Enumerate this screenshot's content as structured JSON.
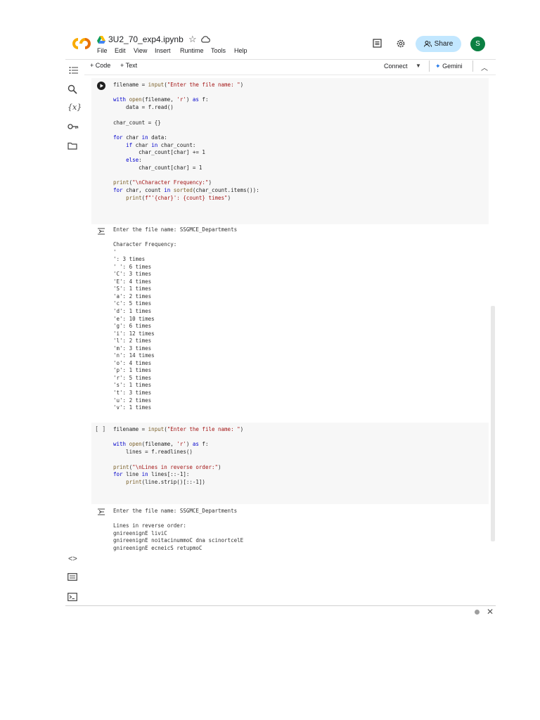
{
  "header": {
    "title": "3U2_70_exp4.ipynb",
    "menu": [
      "File",
      "Edit",
      "View",
      "Insert",
      "Runtime",
      "Tools",
      "Help"
    ],
    "share_label": "Share",
    "avatar_letter": "S"
  },
  "toolbar": {
    "add_code": "+ Code",
    "add_text": "+ Text",
    "connect": "Connect",
    "gemini": "Gemini"
  },
  "cells": [
    {
      "run_state": "play",
      "code": [
        [
          [
            "filename = ",
            "tx"
          ],
          [
            "input",
            "bi"
          ],
          [
            "(",
            "tx"
          ],
          [
            "\"Enter the file name: \"",
            "str"
          ],
          [
            ")",
            "tx"
          ]
        ],
        [],
        [
          [
            "with ",
            "kw"
          ],
          [
            "open",
            "bi"
          ],
          [
            "(filename, ",
            "tx"
          ],
          [
            "'r'",
            "str"
          ],
          [
            ") ",
            "tx"
          ],
          [
            "as",
            "kw"
          ],
          [
            " f:",
            "tx"
          ]
        ],
        [
          [
            "    data = f.read()",
            "tx"
          ]
        ],
        [],
        [
          [
            "char_count = {}",
            "tx"
          ]
        ],
        [],
        [
          [
            "for ",
            "kw"
          ],
          [
            "char ",
            "tx"
          ],
          [
            "in",
            "kw"
          ],
          [
            " data:",
            "tx"
          ]
        ],
        [
          [
            "    ",
            "tx"
          ],
          [
            "if ",
            "kw"
          ],
          [
            "char ",
            "tx"
          ],
          [
            "in",
            "kw"
          ],
          [
            " char_count:",
            "tx"
          ]
        ],
        [
          [
            "        char_count[char] += 1",
            "tx"
          ]
        ],
        [
          [
            "    ",
            "tx"
          ],
          [
            "else",
            "kw"
          ],
          [
            ":",
            "tx"
          ]
        ],
        [
          [
            "        char_count[char] = 1",
            "tx"
          ]
        ],
        [],
        [
          [
            "print",
            "bi"
          ],
          [
            "(",
            "tx"
          ],
          [
            "\"\\nCharacter Frequency:\"",
            "str"
          ],
          [
            ")",
            "tx"
          ]
        ],
        [
          [
            "for ",
            "kw"
          ],
          [
            "char, count ",
            "tx"
          ],
          [
            "in ",
            "kw"
          ],
          [
            "sorted",
            "bi"
          ],
          [
            "(char_count.items()):",
            "tx"
          ]
        ],
        [
          [
            "    ",
            "tx"
          ],
          [
            "print",
            "bi"
          ],
          [
            "(",
            "tx"
          ],
          [
            "f\"'{char}': {count} times\"",
            "str"
          ],
          [
            ")",
            "tx"
          ]
        ]
      ],
      "output": [
        "Enter the file name: SSGMCE_Departments",
        "",
        "Character Frequency:",
        "'",
        "': 3 times",
        "' ': 6 times",
        "'C': 3 times",
        "'E': 4 times",
        "'S': 1 times",
        "'a': 2 times",
        "'c': 5 times",
        "'d': 1 times",
        "'e': 10 times",
        "'g': 6 times",
        "'i': 12 times",
        "'l': 2 times",
        "'m': 3 times",
        "'n': 14 times",
        "'o': 4 times",
        "'p': 1 times",
        "'r': 5 times",
        "'s': 1 times",
        "'t': 3 times",
        "'u': 2 times",
        "'v': 1 times"
      ]
    },
    {
      "run_state": "[ ]",
      "code": [
        [
          [
            "filename = ",
            "tx"
          ],
          [
            "input",
            "bi"
          ],
          [
            "(",
            "tx"
          ],
          [
            "\"Enter the file name: \"",
            "str"
          ],
          [
            ")",
            "tx"
          ]
        ],
        [],
        [
          [
            "with ",
            "kw"
          ],
          [
            "open",
            "bi"
          ],
          [
            "(filename, ",
            "tx"
          ],
          [
            "'r'",
            "str"
          ],
          [
            ") ",
            "tx"
          ],
          [
            "as",
            "kw"
          ],
          [
            " f:",
            "tx"
          ]
        ],
        [
          [
            "    lines = f.readlines()",
            "tx"
          ]
        ],
        [],
        [
          [
            "print",
            "bi"
          ],
          [
            "(",
            "tx"
          ],
          [
            "\"\\nLines in reverse order:\"",
            "str"
          ],
          [
            ")",
            "tx"
          ]
        ],
        [
          [
            "for ",
            "kw"
          ],
          [
            "line ",
            "tx"
          ],
          [
            "in",
            "kw"
          ],
          [
            " lines[::-1]:",
            "tx"
          ]
        ],
        [
          [
            "    ",
            "tx"
          ],
          [
            "print",
            "bi"
          ],
          [
            "(line.strip()[::-1])",
            "tx"
          ]
        ]
      ],
      "output": [
        "Enter the file name: SSGMCE_Departments",
        "",
        "Lines in reverse order:",
        "gnireenignE liviC",
        "gnireenignE noitacinummoC dna scinortcelE",
        "gnireenignE ecneicS retupmoC"
      ]
    }
  ]
}
